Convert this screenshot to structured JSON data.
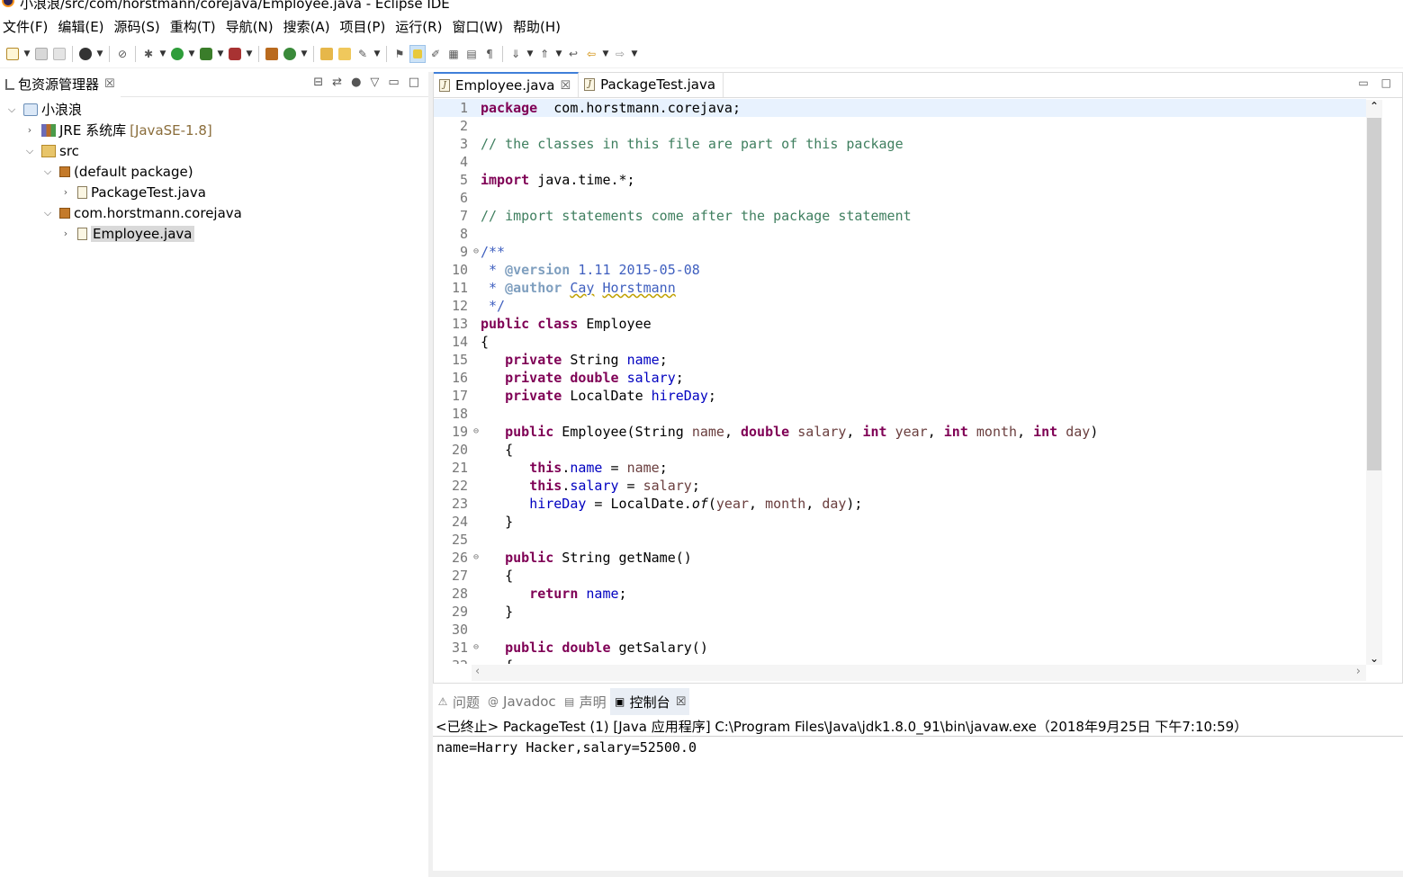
{
  "window": {
    "title": "小浪浪/src/com/horstmann/corejava/Employee.java - Eclipse IDE"
  },
  "menu": [
    "文件(F)",
    "编辑(E)",
    "源码(S)",
    "重构(T)",
    "导航(N)",
    "搜索(A)",
    "项目(P)",
    "运行(R)",
    "窗口(W)",
    "帮助(H)"
  ],
  "package_explorer": {
    "tab_label": "包资源管理器",
    "close_glyph": "☒",
    "tree": [
      {
        "label": "小浪浪",
        "indent": 0,
        "expanded": true,
        "icon": "project-icon"
      },
      {
        "label": "JRE 系统库",
        "decoration": "[JavaSE-1.8]",
        "indent": 1,
        "expanded": false,
        "icon": "library-icon"
      },
      {
        "label": "src",
        "indent": 1,
        "expanded": true,
        "icon": "source-folder-icon"
      },
      {
        "label": "(default package)",
        "indent": 2,
        "expanded": true,
        "icon": "package-icon"
      },
      {
        "label": "PackageTest.java",
        "indent": 3,
        "expanded": false,
        "icon": "java-file-icon"
      },
      {
        "label": "com.horstmann.corejava",
        "indent": 2,
        "expanded": true,
        "icon": "package-icon"
      },
      {
        "label": "Employee.java",
        "indent": 3,
        "expanded": false,
        "icon": "java-file-icon",
        "selected": true
      }
    ]
  },
  "editor": {
    "tabs": [
      {
        "label": "Employee.java",
        "active": true,
        "close_glyph": "☒"
      },
      {
        "label": "PackageTest.java",
        "active": false
      }
    ],
    "lines": [
      {
        "n": "1",
        "tokens": [
          [
            "kw",
            "package"
          ],
          [
            "",
            "  com.horstmann.corejava;"
          ]
        ]
      },
      {
        "n": "2",
        "tokens": []
      },
      {
        "n": "3",
        "tokens": [
          [
            "cm",
            "// the classes in this file are part of this package"
          ]
        ]
      },
      {
        "n": "4",
        "tokens": []
      },
      {
        "n": "5",
        "tokens": [
          [
            "kw",
            "import"
          ],
          [
            "",
            " java.time.*;"
          ]
        ]
      },
      {
        "n": "6",
        "tokens": []
      },
      {
        "n": "7",
        "tokens": [
          [
            "cm",
            "// import statements come after the package statement"
          ]
        ]
      },
      {
        "n": "8",
        "tokens": []
      },
      {
        "n": "9",
        "fold": true,
        "tokens": [
          [
            "jd",
            "/**"
          ]
        ]
      },
      {
        "n": "10",
        "tokens": [
          [
            "jd",
            " * "
          ],
          [
            "jdtag",
            "@version"
          ],
          [
            "jd",
            " 1.11 2015-05-08"
          ]
        ]
      },
      {
        "n": "11",
        "tokens": [
          [
            "jd",
            " * "
          ],
          [
            "jdtag",
            "@author"
          ],
          [
            "jd",
            " "
          ],
          [
            "jd sq",
            "Cay"
          ],
          [
            "jd",
            " "
          ],
          [
            "jd sq",
            "Horstmann"
          ]
        ]
      },
      {
        "n": "12",
        "tokens": [
          [
            "jd",
            " */"
          ]
        ]
      },
      {
        "n": "13",
        "tokens": [
          [
            "kw",
            "public"
          ],
          [
            "",
            " "
          ],
          [
            "kw",
            "class"
          ],
          [
            "",
            " Employee"
          ]
        ]
      },
      {
        "n": "14",
        "tokens": [
          [
            "",
            "{"
          ]
        ]
      },
      {
        "n": "15",
        "tokens": [
          [
            "",
            "   "
          ],
          [
            "kw",
            "private"
          ],
          [
            "",
            " String "
          ],
          [
            "fld",
            "name"
          ],
          [
            "",
            ";"
          ]
        ]
      },
      {
        "n": "16",
        "tokens": [
          [
            "",
            "   "
          ],
          [
            "kw",
            "private"
          ],
          [
            "",
            " "
          ],
          [
            "kw",
            "double"
          ],
          [
            "",
            " "
          ],
          [
            "fld",
            "salary"
          ],
          [
            "",
            ";"
          ]
        ]
      },
      {
        "n": "17",
        "tokens": [
          [
            "",
            "   "
          ],
          [
            "kw",
            "private"
          ],
          [
            "",
            " LocalDate "
          ],
          [
            "fld",
            "hireDay"
          ],
          [
            "",
            ";"
          ]
        ]
      },
      {
        "n": "18",
        "tokens": []
      },
      {
        "n": "19",
        "fold": true,
        "tokens": [
          [
            "",
            "   "
          ],
          [
            "kw",
            "public"
          ],
          [
            "",
            " Employee(String "
          ],
          [
            "par",
            "name"
          ],
          [
            "",
            ", "
          ],
          [
            "kw",
            "double"
          ],
          [
            "",
            " "
          ],
          [
            "par",
            "salary"
          ],
          [
            "",
            ", "
          ],
          [
            "kw",
            "int"
          ],
          [
            "",
            " "
          ],
          [
            "par",
            "year"
          ],
          [
            "",
            ", "
          ],
          [
            "kw",
            "int"
          ],
          [
            "",
            " "
          ],
          [
            "par",
            "month"
          ],
          [
            "",
            ", "
          ],
          [
            "kw",
            "int"
          ],
          [
            "",
            " "
          ],
          [
            "par",
            "day"
          ],
          [
            "",
            ")"
          ]
        ]
      },
      {
        "n": "20",
        "tokens": [
          [
            "",
            "   {"
          ]
        ]
      },
      {
        "n": "21",
        "tokens": [
          [
            "",
            "      "
          ],
          [
            "kw",
            "this"
          ],
          [
            "",
            "."
          ],
          [
            "fld",
            "name"
          ],
          [
            "",
            " = "
          ],
          [
            "par",
            "name"
          ],
          [
            "",
            ";"
          ]
        ]
      },
      {
        "n": "22",
        "tokens": [
          [
            "",
            "      "
          ],
          [
            "kw",
            "this"
          ],
          [
            "",
            "."
          ],
          [
            "fld",
            "salary"
          ],
          [
            "",
            " = "
          ],
          [
            "par",
            "salary"
          ],
          [
            "",
            ";"
          ]
        ]
      },
      {
        "n": "23",
        "tokens": [
          [
            "",
            "      "
          ],
          [
            "fld",
            "hireDay"
          ],
          [
            "",
            " = LocalDate."
          ],
          [
            "itl",
            "of"
          ],
          [
            "",
            "("
          ],
          [
            "par",
            "year"
          ],
          [
            "",
            ", "
          ],
          [
            "par",
            "month"
          ],
          [
            "",
            ", "
          ],
          [
            "par",
            "day"
          ],
          [
            "",
            ");"
          ]
        ]
      },
      {
        "n": "24",
        "tokens": [
          [
            "",
            "   }"
          ]
        ]
      },
      {
        "n": "25",
        "tokens": []
      },
      {
        "n": "26",
        "fold": true,
        "tokens": [
          [
            "",
            "   "
          ],
          [
            "kw",
            "public"
          ],
          [
            "",
            " String getName()"
          ]
        ]
      },
      {
        "n": "27",
        "tokens": [
          [
            "",
            "   {"
          ]
        ]
      },
      {
        "n": "28",
        "tokens": [
          [
            "",
            "      "
          ],
          [
            "kw",
            "return"
          ],
          [
            "",
            " "
          ],
          [
            "fld",
            "name"
          ],
          [
            "",
            ";"
          ]
        ]
      },
      {
        "n": "29",
        "tokens": [
          [
            "",
            "   }"
          ]
        ]
      },
      {
        "n": "30",
        "tokens": []
      },
      {
        "n": "31",
        "fold": true,
        "tokens": [
          [
            "",
            "   "
          ],
          [
            "kw",
            "public"
          ],
          [
            "",
            " "
          ],
          [
            "kw",
            "double"
          ],
          [
            "",
            " getSalary()"
          ]
        ]
      },
      {
        "n": "32",
        "tokens": [
          [
            "",
            "   {"
          ]
        ]
      }
    ]
  },
  "bottom_panel": {
    "tabs": [
      {
        "label": "问题",
        "icon": "problems-icon",
        "glyph": "⚠",
        "active": false
      },
      {
        "label": "Javadoc",
        "icon": "javadoc-icon",
        "glyph": "@",
        "active": false
      },
      {
        "label": "声明",
        "icon": "declaration-icon",
        "glyph": "▤",
        "active": false
      },
      {
        "label": "控制台",
        "icon": "console-icon",
        "glyph": "▣",
        "active": true
      }
    ],
    "close_glyph": "☒",
    "console_header": "<已终止> PackageTest (1)  [Java 应用程序] C:\\Program Files\\Java\\jdk1.8.0_91\\bin\\javaw.exe（2018年9月25日 下午7:10:59）",
    "console_output": "name=Harry Hacker,salary=52500.0"
  },
  "colors": {
    "keyword": "#7f0055",
    "comment": "#3f7f5f",
    "javadoc": "#3f5fbf",
    "field": "#0000c0",
    "active_tab_accent": "#3f7fd9"
  }
}
